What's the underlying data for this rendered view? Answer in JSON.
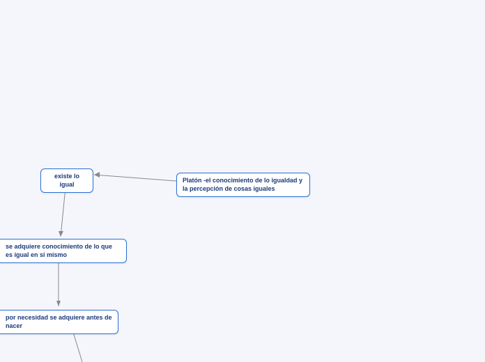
{
  "nodes": {
    "existe": {
      "label": "existe lo igual"
    },
    "platon": {
      "label": "Platón -el conocimiento de lo igualdad y la percepción de cosas iguales"
    },
    "adquiere": {
      "label": "se adquiere conocimiento de lo que es igual en si mismo"
    },
    "necesidad": {
      "label": "por necesidad se adquiere antes de nacer"
    }
  }
}
